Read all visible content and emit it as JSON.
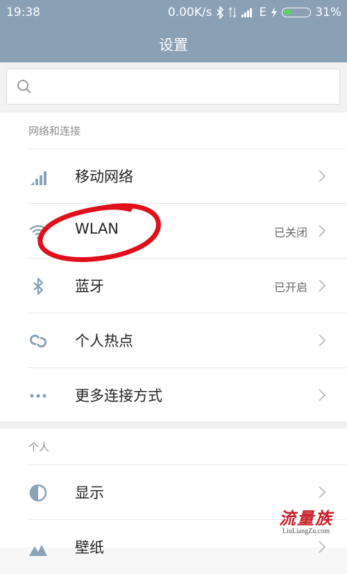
{
  "status_bar": {
    "time": "19:38",
    "net_speed": "0.00K/s",
    "network_type": "E",
    "battery": "31%",
    "battery_fraction": 0.31,
    "icons": [
      "bluetooth-icon",
      "data-transfer-icon",
      "signal-icon",
      "charging-icon",
      "battery-icon"
    ]
  },
  "header": {
    "title": "设置"
  },
  "search": {
    "placeholder": "",
    "icon": "search-icon"
  },
  "sections": [
    {
      "header": "网络和连接",
      "items": [
        {
          "label": "移动网络",
          "status": "",
          "icon": "cellular-signal-icon"
        },
        {
          "label": "WLAN",
          "status": "已关闭",
          "icon": "wifi-icon"
        },
        {
          "label": "蓝牙",
          "status": "已开启",
          "icon": "bluetooth-icon"
        },
        {
          "label": "个人热点",
          "status": "",
          "icon": "hotspot-icon"
        },
        {
          "label": "更多连接方式",
          "status": "",
          "icon": "more-dots-icon"
        }
      ]
    },
    {
      "header": "个人",
      "items": [
        {
          "label": "显示",
          "status": "",
          "icon": "display-icon"
        },
        {
          "label": "壁纸",
          "status": "",
          "icon": "wallpaper-icon"
        }
      ]
    }
  ],
  "watermark": {
    "main": "流量族",
    "sub": "LiuLiangZu.com"
  },
  "colors": {
    "header_bg": "#8aa0b5",
    "icon": "#8aa3b8",
    "annotation": "#e0101a"
  }
}
